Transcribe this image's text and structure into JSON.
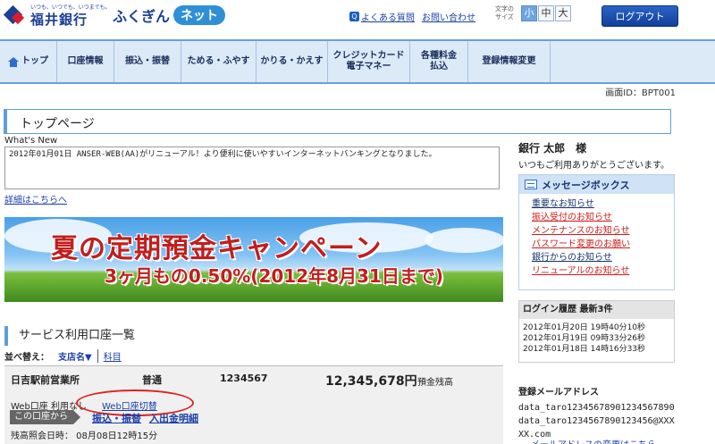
{
  "header": {
    "logo_tagline": "いつも、いつでも、いつまでも。",
    "bank_name": "福井銀行",
    "service_name": "ふくぎん",
    "service_badge": "ネット",
    "faq_icon": "Q",
    "faq_label": "よくある質問",
    "contact_label": "お問い合わせ",
    "font_size_label": "文字の サイズ",
    "font_sizes": [
      "小",
      "中",
      "大"
    ],
    "font_size_selected": "小",
    "logout_label": "ログアウト"
  },
  "nav": {
    "items": [
      {
        "label": "トップ",
        "icon": "home-icon"
      },
      {
        "label": "口座情報"
      },
      {
        "label": "振込・振替"
      },
      {
        "label": "ためる・ふやす"
      },
      {
        "label": "かりる・かえす"
      },
      {
        "label": "クレジットカード",
        "sub": "電子マネー"
      },
      {
        "label": "各種料金",
        "sub": "払込"
      },
      {
        "label": "登録情報変更"
      }
    ]
  },
  "screen_id": "画面ID：BPT001",
  "page_title": "トップページ",
  "whats_new": {
    "label": "What's New",
    "text": "2012年01月01日 ANSER-WEB(AA)がリニューアル！より便利に使いやすいインターネットバンキングとなりました。",
    "details_link": "詳細はこちらへ"
  },
  "banner": {
    "title": "夏の定期預金キャンペーン",
    "subtitle": "3ヶ月もの0.50%(2012年8月31日まで)"
  },
  "accounts": {
    "heading": "サービス利用口座一覧",
    "sort_label": "並べ替え：",
    "sort_branch": "支店名▼",
    "sort_subject": "科目",
    "items": [
      {
        "branch": "日吉駅前営業所",
        "type": "普通",
        "number": "1234567",
        "balance": "12,345,678円",
        "balance_label": "預金残高",
        "web_status": "Web口座 利用なし",
        "web_switch": "Web口座切替",
        "this_account": "この口座から",
        "transfer_link": "振込・振替",
        "history_link": "入出金明細",
        "last_inquiry": "残高照会日時： 08月08日12時15分"
      }
    ]
  },
  "user": {
    "name": "銀行 太郎　様",
    "greeting": "いつもご利用ありがとうございます。"
  },
  "message_box": {
    "title": "メッセージボックス",
    "items": [
      {
        "label": "重要なお知らせ",
        "color": "black"
      },
      {
        "label": "振込受付のお知らせ",
        "color": "red"
      },
      {
        "label": "メンテナンスのお知らせ",
        "color": "red"
      },
      {
        "label": "パスワード変更のお願い",
        "color": "red"
      },
      {
        "label": "銀行からのお知らせ",
        "color": "black"
      },
      {
        "label": "リニューアルのお知らせ",
        "color": "red"
      }
    ]
  },
  "login_history": {
    "title": "ログイン履歴 最新3件",
    "entries": [
      "2012年01月20日 19時40分10秒",
      "2012年01月19日 09時33分26秒",
      "2012年01月18日 14時16分33秒"
    ]
  },
  "email": {
    "heading": "登録メールアドレス",
    "address": "data_taro1234567890123456789​0data_taro1234567890123456@XXXXX.com",
    "change_link": "メールアドレスの変更はこちら"
  },
  "colors": {
    "brand_blue": "#1c3f94",
    "nav_bg": "#dce9f7",
    "accent_line": "#5f9fd8",
    "link": "#1a3fa8",
    "alert_red": "#d11a1a",
    "banner_text": "#c11e1e"
  }
}
